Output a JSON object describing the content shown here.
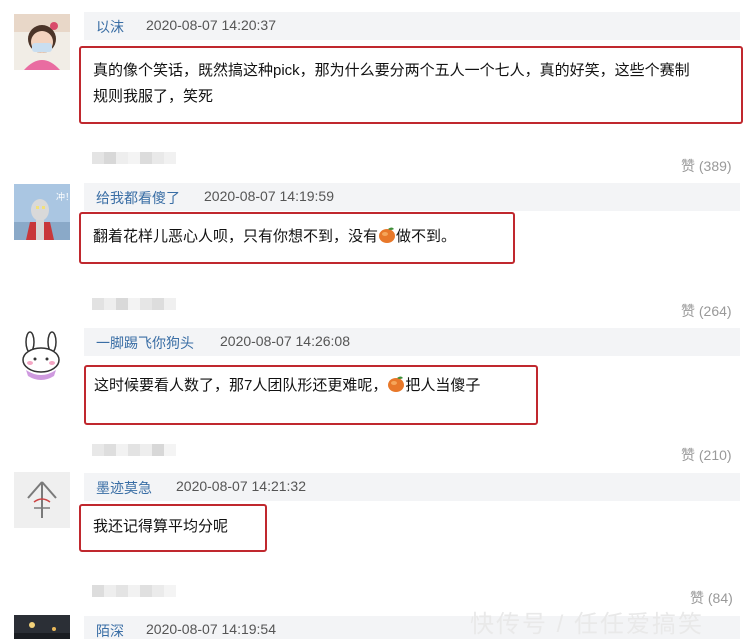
{
  "comments": [
    {
      "username": "以沫",
      "time": "2020-08-07 14:20:37",
      "text_lines": [
        "真的像个笑话，既然搞这种pick，那为什么要分两个五人一个七人，真的好笑，这些个赛制",
        "规则我服了，笑死"
      ],
      "likes": "赞 (389)",
      "avatar": "girl-photo-avatar"
    },
    {
      "username": "给我都看傻了",
      "time": "2020-08-07 14:19:59",
      "text_before": "翻着花样儿恶心人呗，只有你想不到，没有",
      "text_after": "做不到。",
      "likes": "赞 (264)",
      "avatar": "ultraman-avatar",
      "avatar_text": "冲！"
    },
    {
      "username": "一脚踢飞你狗头",
      "time": "2020-08-07 14:26:08",
      "text_before": "这时候要看人数了，那7人团队形还更难呢，",
      "text_after": "把人当傻子",
      "likes": "赞 (210)",
      "avatar": "bunny-avatar"
    },
    {
      "username": "墨迹莫急",
      "time": "2020-08-07 14:21:32",
      "text": "我还记得算平均分呢",
      "likes": "赞 (84)",
      "avatar": "ink-logo-avatar"
    },
    {
      "username": "陌深",
      "time": "2020-08-07 14:19:54",
      "avatar": "night-photo-avatar"
    }
  ],
  "emoji": "mango-emoji",
  "watermark": "快传号 / 任任爱搞笑",
  "colors": {
    "highlight_border": "#c0282e",
    "username": "#3a6ea5",
    "header_bg": "#f3f4f6"
  }
}
